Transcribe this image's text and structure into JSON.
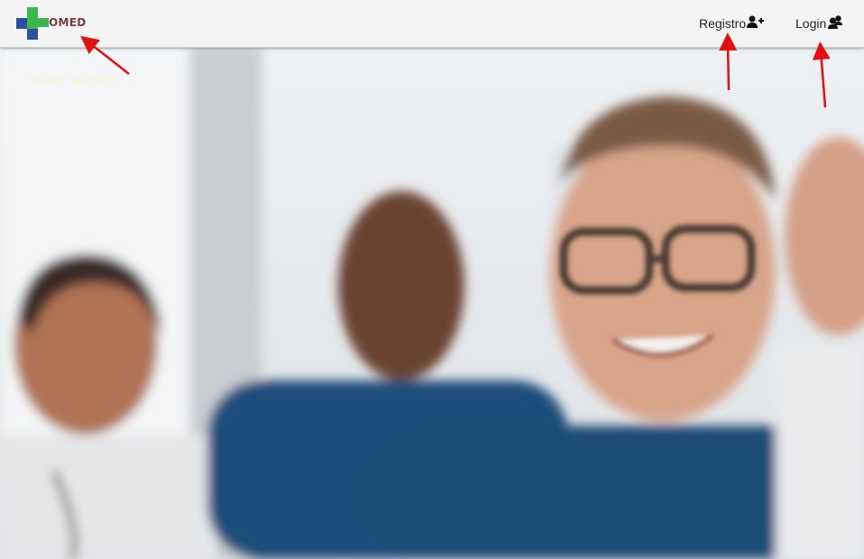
{
  "navbar": {
    "logo": {
      "brand_text": "OMED",
      "icon": "medical-cross-logo-icon"
    },
    "links": [
      {
        "label": "Registro",
        "icon": "user-plus-icon"
      },
      {
        "label": "Login",
        "icon": "users-icon"
      }
    ]
  },
  "main": {
    "text": "Home works!"
  },
  "colors": {
    "navbar_bg": "#f4f4f4",
    "logo_green": "#3cb54a",
    "logo_blue": "#2d4fa0",
    "brand_text": "#7a3b3b",
    "annotation_arrow": "#e01010",
    "scrubs_blue": "#1f4e7a"
  }
}
